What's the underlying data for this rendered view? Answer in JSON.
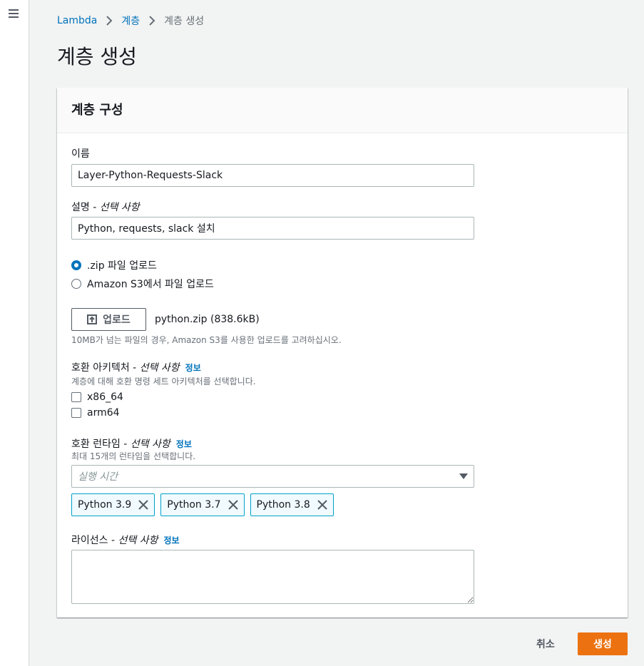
{
  "breadcrumb": {
    "items": [
      {
        "label": "Lambda"
      },
      {
        "label": "계층"
      },
      {
        "label": "계층 생성"
      }
    ]
  },
  "page": {
    "title": "계층 생성"
  },
  "panel": {
    "title": "계층 구성",
    "name": {
      "label": "이름",
      "value": "Layer-Python-Requests-Slack"
    },
    "description": {
      "label": "설명 - ",
      "optional": "선택 사항",
      "value": "Python, requests, slack 설치"
    },
    "upload_options": [
      {
        "label": ".zip 파일 업로드",
        "selected": true
      },
      {
        "label": "Amazon S3에서 파일 업로드",
        "selected": false
      }
    ],
    "upload": {
      "button_label": "업로드",
      "file_info": "python.zip (838.6kB)",
      "hint": "10MB가 넘는 파일의 경우, Amazon S3를 사용한 업로드를 고려하십시오."
    },
    "architectures": {
      "label": "호환 아키텍처 - ",
      "optional": "선택 사항",
      "info": "정보",
      "hint": "계층에 대해 호환 명령 세트 아키텍처를 선택합니다.",
      "options": [
        {
          "label": "x86_64",
          "checked": false
        },
        {
          "label": "arm64",
          "checked": false
        }
      ]
    },
    "runtimes": {
      "label": "호환 런타임 - ",
      "optional": "선택 사항",
      "info": "정보",
      "hint": "최대 15개의 런타임을 선택합니다.",
      "placeholder": "실행 시간",
      "selected": [
        "Python 3.9",
        "Python 3.7",
        "Python 3.8"
      ]
    },
    "license": {
      "label": "라이선스 - ",
      "optional": "선택 사항",
      "info": "정보",
      "value": ""
    }
  },
  "footer": {
    "cancel_label": "취소",
    "create_label": "생성"
  },
  "colors": {
    "link": "#0073bb",
    "primary_button": "#ec7211",
    "token_border": "#00a1c9"
  }
}
